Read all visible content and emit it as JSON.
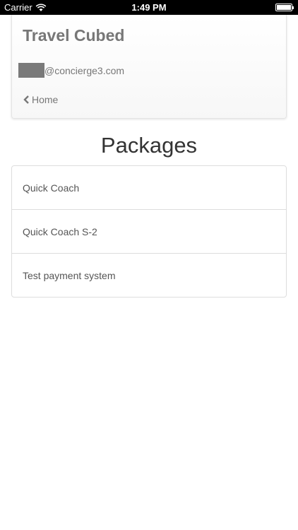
{
  "status_bar": {
    "carrier": "Carrier",
    "time": "1:49 PM"
  },
  "header": {
    "title": "Travel Cubed",
    "email_suffix": "@concierge3.com",
    "home_label": "Home"
  },
  "page": {
    "title": "Packages"
  },
  "packages": [
    {
      "label": "Quick Coach"
    },
    {
      "label": "Quick Coach S-2"
    },
    {
      "label": "Test payment system"
    }
  ]
}
